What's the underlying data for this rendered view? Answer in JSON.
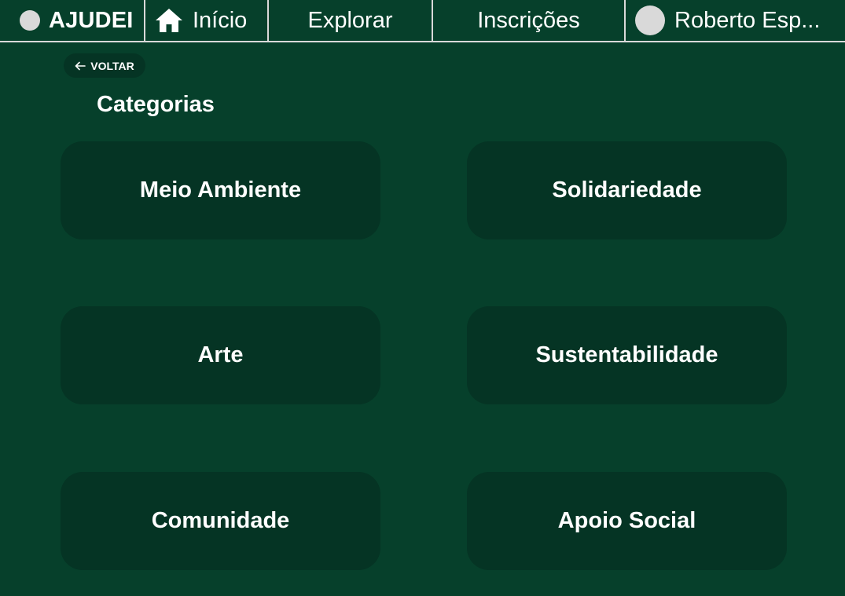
{
  "header": {
    "brand": "AJUDEI",
    "nav": {
      "home": "Início",
      "explore": "Explorar",
      "subscriptions": "Inscrições"
    },
    "user_name": "Roberto Esp..."
  },
  "back_button": {
    "label": "VOLTAR"
  },
  "categories": {
    "title": "Categorias",
    "items": [
      {
        "label": "Meio Ambiente"
      },
      {
        "label": "Solidariedade"
      },
      {
        "label": "Arte"
      },
      {
        "label": "Sustentabilidade"
      },
      {
        "label": "Comunidade"
      },
      {
        "label": "Apoio Social"
      }
    ]
  },
  "colors": {
    "background": "#06402b",
    "card": "#053424",
    "divider": "#d9d9d9",
    "text": "#ffffff"
  },
  "icons": {
    "brand": "logo-circle-icon",
    "home": "home-icon",
    "avatar": "avatar-icon",
    "back": "arrow-left-icon"
  }
}
